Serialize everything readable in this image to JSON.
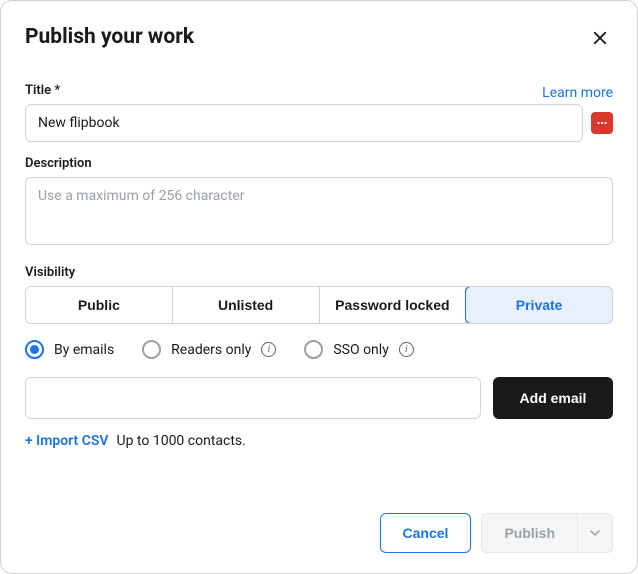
{
  "header": {
    "title": "Publish your work"
  },
  "links": {
    "learn_more": "Learn more",
    "import_csv": "+ Import CSV"
  },
  "labels": {
    "title": "Title *",
    "description": "Description",
    "visibility": "Visibility",
    "contacts_note": "Up to 1000 contacts."
  },
  "fields": {
    "title_value": "New flipbook",
    "description_placeholder": "Use a maximum of 256 character",
    "email_value": ""
  },
  "visibility": {
    "options": [
      "Public",
      "Unlisted",
      "Password locked",
      "Private"
    ],
    "selected": "Private"
  },
  "private_modes": {
    "by_emails": "By emails",
    "readers_only": "Readers only",
    "sso_only": "SSO only",
    "selected": "by_emails"
  },
  "buttons": {
    "add_email": "Add email",
    "cancel": "Cancel",
    "publish": "Publish"
  }
}
